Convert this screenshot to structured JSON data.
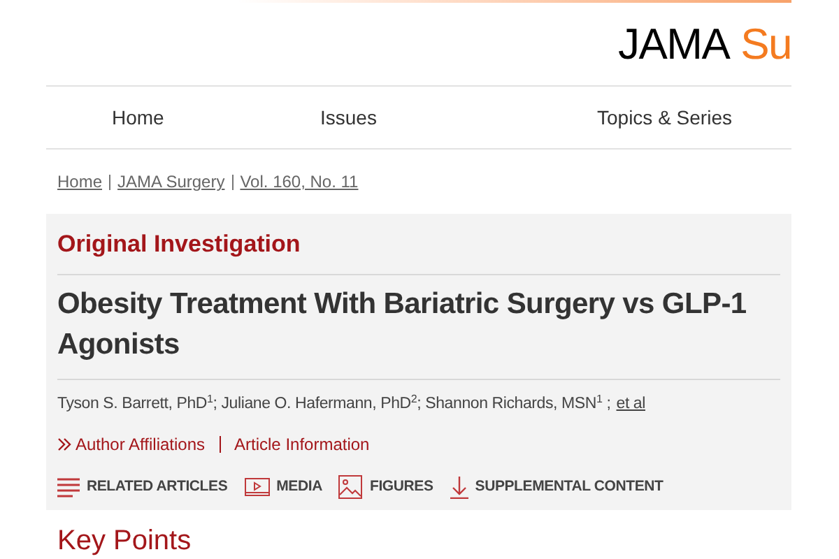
{
  "logo": {
    "primary": "JAMA",
    "secondary": "Su"
  },
  "nav": [
    {
      "label": "Home"
    },
    {
      "label": "Issues"
    },
    {
      "label": "Topics & Series"
    }
  ],
  "breadcrumb": [
    "Home",
    "JAMA Surgery",
    "Vol. 160, No. 11"
  ],
  "article": {
    "type": "Original Investigation",
    "title": "Obesity Treatment With Bariatric Surgery vs GLP-1 Agonists",
    "authors": "Tyson S. Barrett, PhD$^{1}$; Juliane O. Hafermann, PhD$^{2}$; Shannon Richards, MSN$^{1}$ ;",
    "et_al": "et al",
    "info_links": [
      "Author Affiliations",
      "Article Information"
    ],
    "tools": [
      {
        "kind": "list",
        "label": "RELATED ARTICLES"
      },
      {
        "kind": "media",
        "label": "MEDIA"
      },
      {
        "kind": "image",
        "label": "FIGURES"
      },
      {
        "kind": "download",
        "label": "SUPPLEMENTAL CONTENT"
      }
    ]
  },
  "section_heading": "Key Points"
}
